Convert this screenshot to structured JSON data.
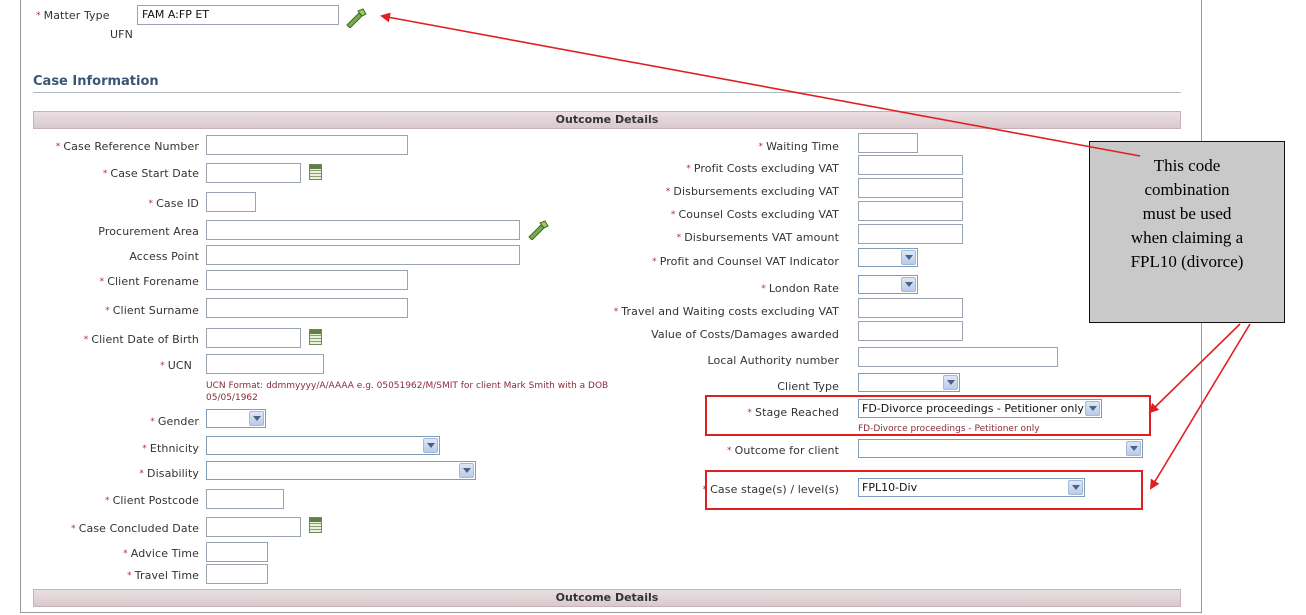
{
  "header": {
    "matter_type_label": "Matter Type",
    "matter_type_value": "FAM A:FP ET",
    "ufn_label": "UFN"
  },
  "section_title": "Case Information",
  "outcome_bar": "Outcome Details",
  "left_fields": {
    "case_reference_number": "Case Reference Number",
    "case_start_date": "Case Start Date",
    "case_id": "Case ID",
    "procurement_area": "Procurement Area",
    "access_point": "Access Point",
    "client_forename": "Client Forename",
    "client_surname": "Client Surname",
    "client_dob": "Client Date of Birth",
    "ucn": "UCN",
    "ucn_hint_line1": "UCN Format: ddmmyyyy/A/AAAA e.g. 05051962/M/SMIT for client Mark Smith with a DOB",
    "ucn_hint_line2": "05/05/1962",
    "gender": "Gender",
    "ethnicity": "Ethnicity",
    "disability": "Disability",
    "client_postcode": "Client Postcode",
    "case_concluded_date": "Case Concluded Date",
    "advice_time": "Advice Time",
    "travel_time": "Travel Time"
  },
  "right_fields": {
    "waiting_time": "Waiting Time",
    "profit_costs": "Profit Costs excluding VAT",
    "disbursements": "Disbursements excluding VAT",
    "counsel_costs": "Counsel Costs excluding VAT",
    "disbursements_vat": "Disbursements VAT amount",
    "profit_counsel_vat": "Profit and Counsel VAT Indicator",
    "london_rate": "London Rate",
    "travel_waiting": "Travel and Waiting costs excluding VAT",
    "value_costs": "Value of Costs/Damages awarded",
    "local_authority": "Local Authority number",
    "client_type": "Client Type",
    "stage_reached": "Stage Reached",
    "stage_reached_value": "FD-Divorce proceedings - Petitioner only",
    "stage_reached_hint": "FD-Divorce proceedings - Petitioner only",
    "outcome_for_client": "Outcome for client",
    "case_stage": "Case stage(s) / level(s)",
    "case_stage_value": "FPL10-Div"
  },
  "callout": {
    "line1": "This code",
    "line2": "combination",
    "line3": "must be used",
    "line4": "when claiming a",
    "line5": "FPL10 (divorce)"
  },
  "colors": {
    "annotation_red": "#e02020",
    "outcome_bar": "#dccdd1",
    "required_star": "#b03030"
  }
}
